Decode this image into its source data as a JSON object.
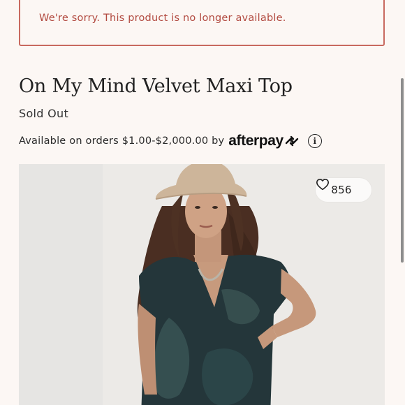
{
  "alert": {
    "message": "We're sorry. This product is no longer available."
  },
  "product": {
    "title": "On My Mind Velvet Maxi Top",
    "status": "Sold Out"
  },
  "afterpay": {
    "text": "Available on orders $1.00-$2,000.00 by",
    "brand": "afterpay",
    "info_icon": "info-icon"
  },
  "image": {
    "like_count": "856",
    "heart_icon": "heart-outline-icon"
  },
  "colors": {
    "alert_border": "#c8695f",
    "alert_text": "#b24a40",
    "background": "#fcf7f4"
  }
}
